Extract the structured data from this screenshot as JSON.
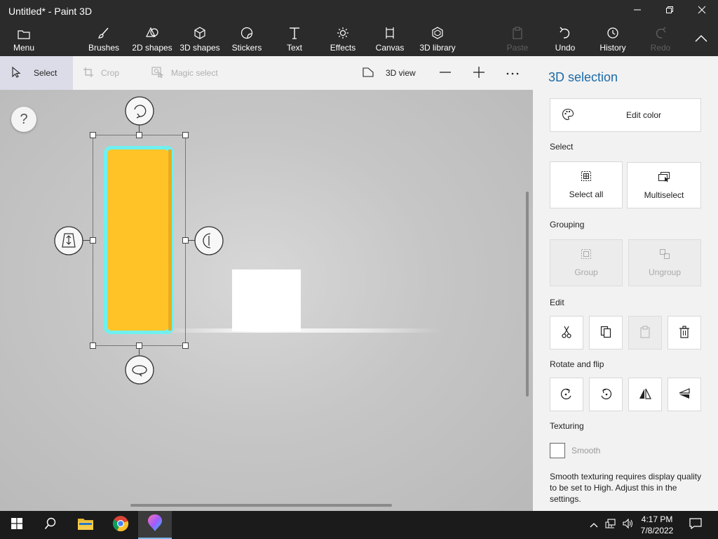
{
  "window": {
    "title": "Untitled* - Paint 3D",
    "minimize_icon": "minimize-icon",
    "restore_icon": "restore-icon",
    "close_icon": "close-icon"
  },
  "toolbar": {
    "menu": "Menu",
    "brushes": "Brushes",
    "shapes2d": "2D shapes",
    "shapes3d": "3D shapes",
    "stickers": "Stickers",
    "text": "Text",
    "effects": "Effects",
    "canvas": "Canvas",
    "library3d": "3D library",
    "paste": "Paste",
    "undo": "Undo",
    "history": "History",
    "redo": "Redo"
  },
  "subbar": {
    "select": "Select",
    "crop": "Crop",
    "magic_select": "Magic select",
    "view3d": "3D view",
    "zoom_out_icon": "minus-icon",
    "zoom_in_icon": "plus-icon",
    "more_icon": "ellipsis-icon"
  },
  "canvas": {
    "help": "?",
    "selected_object_color": "#FFC328",
    "selection_outline_color": "#6FF0F0"
  },
  "panel": {
    "title": "3D selection",
    "edit_color": "Edit color",
    "select_section": "Select",
    "select_all": "Select all",
    "multiselect": "Multiselect",
    "grouping_section": "Grouping",
    "group": "Group",
    "ungroup": "Ungroup",
    "edit_section": "Edit",
    "rotate_section": "Rotate and flip",
    "texturing_section": "Texturing",
    "smooth": "Smooth",
    "note": "Smooth texturing requires display quality to be set to High. Adjust this in the settings."
  },
  "taskbar": {
    "time": "4:17 PM",
    "date": "7/8/2022"
  },
  "colors": {
    "accent": "#1B6AA8",
    "chrome": "#2B2B2B"
  }
}
